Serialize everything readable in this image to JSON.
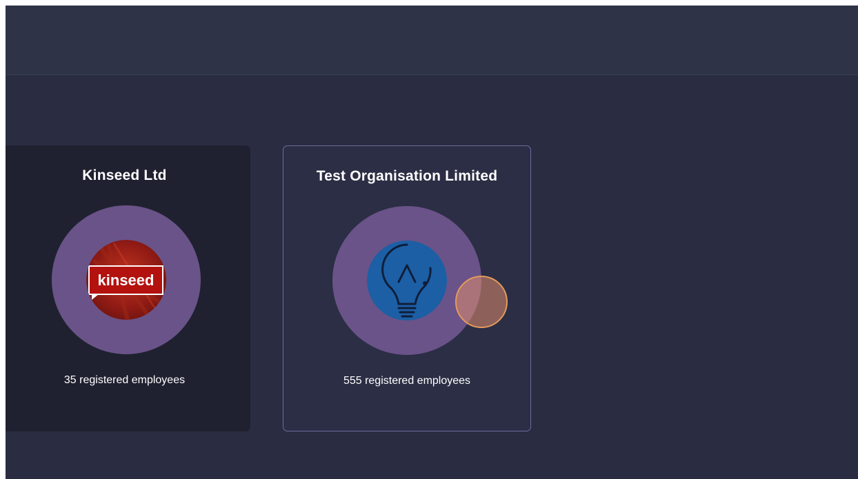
{
  "cards": [
    {
      "name": "Kinseed Ltd",
      "logo_text": "kinseed",
      "employees": "35 registered employees"
    },
    {
      "name": "Test Organisation Limited",
      "employees": "555 registered employees"
    }
  ],
  "colors": {
    "background": "#2a2d42",
    "topbar": "#2f3347",
    "ring": "#6a5388",
    "selected_border": "#6e6aa0",
    "kinseed_red": "#b3120f",
    "bulb_blue": "#1c5fa5"
  },
  "icons": [
    "kinseed-logo",
    "lightbulb-icon"
  ]
}
